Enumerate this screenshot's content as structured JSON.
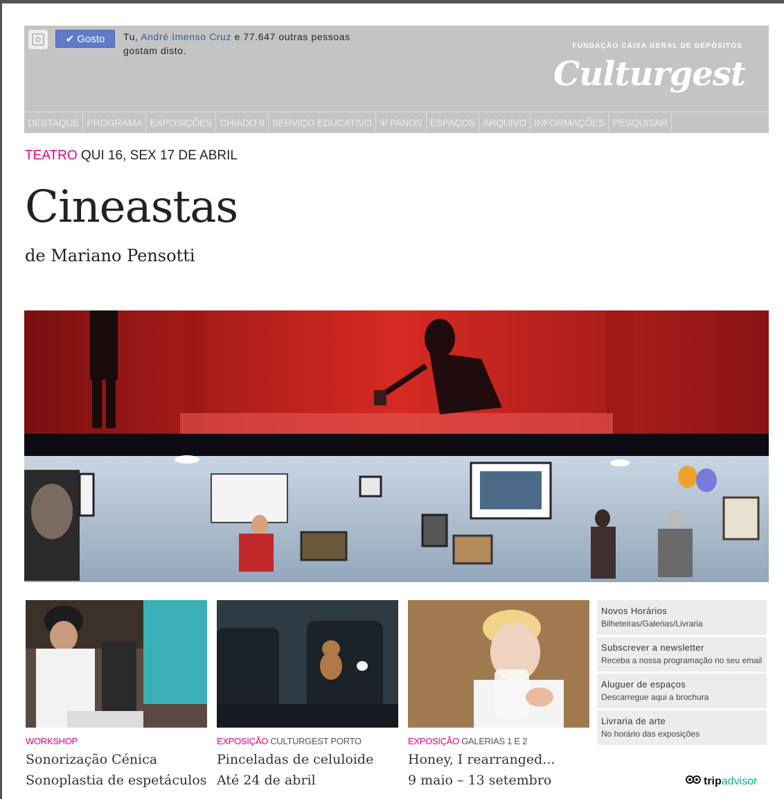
{
  "header": {
    "like_button": "Gosto",
    "like_prefix": "Tu, ",
    "like_name": "André Imenso Cruz",
    "like_suffix": "e 77.647 outras pessoas gostam disto.",
    "brand_sub": "FUNDAÇÃO CAIXA GERAL DE DEPÓSITOS",
    "brand_logo": "Culturgest"
  },
  "nav": [
    "DESTAQUE",
    "PROGRAMA",
    "EXPOSIÇÕES",
    "CHIADO 8",
    "SERVIÇO EDUCATIVO",
    "Ψ PANOS",
    "ESPAÇOS",
    "ARQUIVO",
    "INFORMAÇÕES",
    "PESQUISAR"
  ],
  "event": {
    "category": "TEATRO",
    "dates": " QUI 16, SEX 17 DE ABRIL",
    "title": "Cineastas",
    "author": "de Mariano Pensotti"
  },
  "cards": [
    {
      "category": "WORKSHOP",
      "location": "",
      "title": "Sonorização Cénica",
      "subtitle": "Sonoplastia de espetáculos"
    },
    {
      "category": "EXPOSIÇÃO",
      "location": " CULTURGEST PORTO",
      "title": "Pinceladas de celuloide",
      "subtitle": "Até 24 de abril"
    },
    {
      "category": "EXPOSIÇÃO",
      "location": " GALERIAS 1 E 2",
      "title": "Honey, I rearranged...",
      "subtitle": "9 maio – 13 setembro"
    }
  ],
  "side": [
    {
      "heading": "Novos Horários",
      "desc": "Bilheteiras/Galerias/Livraria"
    },
    {
      "heading": "Subscrever a newsletter",
      "desc": "Receba a nossa programação no seu email"
    },
    {
      "heading": "Aluguer de espaços",
      "desc": "Descarregue aqui a brochura"
    },
    {
      "heading": "Livraria de arte",
      "desc": "No horário das exposições"
    }
  ],
  "tripadvisor": {
    "trip": "trip",
    "advisor": "advisor"
  },
  "colors": {
    "accent": "#e6007e",
    "header_bg": "#c4c4c4",
    "like_blue": "#5f7cc8"
  }
}
